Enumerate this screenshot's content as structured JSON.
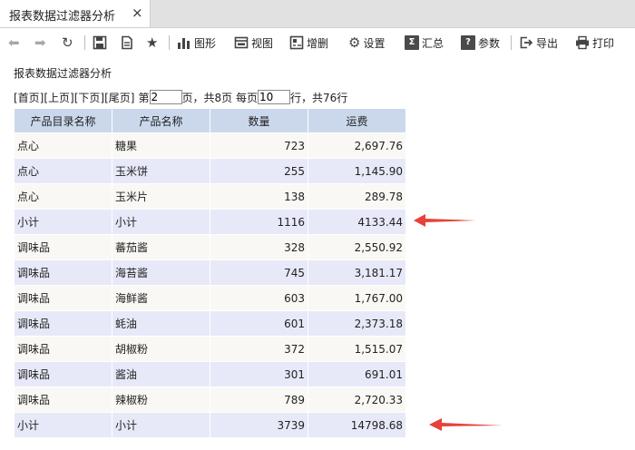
{
  "tab": {
    "title": "报表数据过滤器分析",
    "close": "×"
  },
  "toolbar": {
    "chart": "图形",
    "view": "视图",
    "crud": "增删",
    "settings": "设置",
    "summary": "汇总",
    "params": "参数",
    "export": "导出",
    "print": "打印"
  },
  "report": {
    "title": "报表数据过滤器分析",
    "pager": {
      "first": "[首页]",
      "prev": "[上页]",
      "next": "[下页]",
      "last": "[尾页]",
      "page_prefix": "第",
      "page_value": "2",
      "page_suffix": "页，共8页 每页",
      "per_page_value": "10",
      "rows_suffix": "行，共76行"
    },
    "columns": [
      "产品目录名称",
      "产品名称",
      "数量",
      "运费"
    ],
    "rows": [
      {
        "category": "点心",
        "product": "糖果",
        "qty": "723",
        "freight": "2,697.76"
      },
      {
        "category": "点心",
        "product": "玉米饼",
        "qty": "255",
        "freight": "1,145.90"
      },
      {
        "category": "点心",
        "product": "玉米片",
        "qty": "138",
        "freight": "289.78"
      },
      {
        "category": "小计",
        "product": "小计",
        "qty": "1116",
        "freight": "4133.44"
      },
      {
        "category": "调味品",
        "product": "蕃茄酱",
        "qty": "328",
        "freight": "2,550.92"
      },
      {
        "category": "调味品",
        "product": "海苔酱",
        "qty": "745",
        "freight": "3,181.17"
      },
      {
        "category": "调味品",
        "product": "海鲜酱",
        "qty": "603",
        "freight": "1,767.00"
      },
      {
        "category": "调味品",
        "product": "蚝油",
        "qty": "601",
        "freight": "2,373.18"
      },
      {
        "category": "调味品",
        "product": "胡椒粉",
        "qty": "372",
        "freight": "1,515.07"
      },
      {
        "category": "调味品",
        "product": "酱油",
        "qty": "301",
        "freight": "691.01"
      },
      {
        "category": "调味品",
        "product": "辣椒粉",
        "qty": "789",
        "freight": "2,720.33"
      },
      {
        "category": "小计",
        "product": "小计",
        "qty": "3739",
        "freight": "14798.68"
      }
    ]
  },
  "colors": {
    "header_bg": "#cbd8ec",
    "row_tint": "#e7e9f8",
    "arrow": "#e8403a"
  }
}
